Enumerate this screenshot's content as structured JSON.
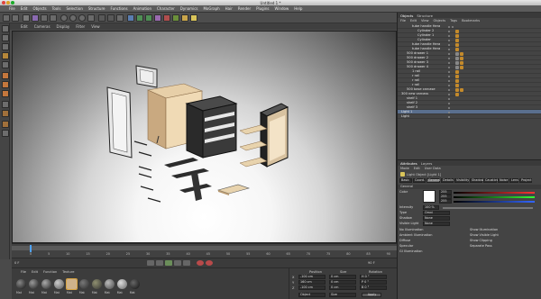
{
  "window": {
    "title": "Untitled 1 *"
  },
  "menubar": [
    "File",
    "Edit",
    "Objects",
    "Tools",
    "Selection",
    "Structure",
    "Functions",
    "Animation",
    "Character",
    "Dynamics",
    "MoGraph",
    "Hair",
    "Render",
    "Plugins",
    "Window",
    "Help"
  ],
  "viewport_menu": [
    "Edit",
    "Cameras",
    "Display",
    "Filter",
    "View"
  ],
  "object_manager": {
    "tabs": [
      "Objects",
      "Structure"
    ],
    "menu": [
      "File",
      "Edit",
      "View",
      "Objects",
      "Tags",
      "Bookmarks"
    ],
    "items": [
      "tube handle Hera",
      "Cylinder 2",
      "Cylinder 1",
      "Cylinder",
      "tube handle Hera",
      "tube handle Hera",
      "500 drawer 1",
      "500 drawer 2",
      "500 drawer 3",
      "500 drawer 4",
      "1 rail",
      "r rail",
      "r rail",
      "r rail",
      "500 base carcase",
      "300 new carcass",
      "shelf 1",
      "shelf 2",
      "shelf 3",
      "Light 1",
      "Light"
    ]
  },
  "attribute_manager": {
    "tabs": [
      "Attributes",
      "Layers"
    ],
    "menu": [
      "Mode",
      "Edit",
      "User Data"
    ],
    "object_label": "Light Object [Light 1]",
    "subtabs": [
      "Basic",
      "Coord.",
      "General",
      "Details",
      "Visibility",
      "Shadow",
      "Caustics",
      "Noise",
      "Lens",
      "Project"
    ],
    "section": "General",
    "fields": [
      {
        "label": "Color",
        "values": [
          "255",
          "255",
          "255"
        ]
      },
      {
        "label": "Intensity",
        "value": "100 %"
      },
      {
        "label": "Type",
        "value": "Omni"
      },
      {
        "label": "Shadow",
        "value": "None"
      },
      {
        "label": "Visible Light",
        "value": "None"
      }
    ],
    "checks_left": [
      "No Illumination",
      "Ambient Illumination",
      "Diffuse",
      "Specular",
      "GI Illumination"
    ],
    "checks_right": [
      "Show Illumination",
      "Show Visible Light",
      "Show Clipping",
      "Separate Pass"
    ]
  },
  "timeline": {
    "ticks": [
      "0",
      "5",
      "10",
      "15",
      "20",
      "25",
      "30",
      "35",
      "40",
      "45",
      "50",
      "55",
      "60",
      "65",
      "70",
      "75",
      "80",
      "85",
      "90"
    ],
    "frame": "0 F",
    "end": "90 F"
  },
  "material_manager": {
    "menu": [
      "File",
      "Edit",
      "Function",
      "Texture"
    ],
    "materials": [
      "Mat",
      "Mat",
      "Mat",
      "Mat",
      "Mat",
      "Mat",
      "Mat",
      "Mat",
      "Mat",
      "Mat"
    ]
  },
  "coordinates": {
    "headers": [
      "Position",
      "Size",
      "Rotation"
    ],
    "rows": [
      {
        "axis": "X",
        "pos": "-100 cm",
        "size": "0 cm",
        "rot": "H 0 °"
      },
      {
        "axis": "Y",
        "pos": "160 cm",
        "size": "0 cm",
        "rot": "P 0 °"
      },
      {
        "axis": "Z",
        "pos": "-100 cm",
        "size": "0 cm",
        "rot": "B 0 °"
      }
    ],
    "mode": "Object",
    "size_mode": "Size",
    "apply": "Apply"
  },
  "colors": {
    "accent": "#c48a2b",
    "selection": "#5a6f8e"
  }
}
